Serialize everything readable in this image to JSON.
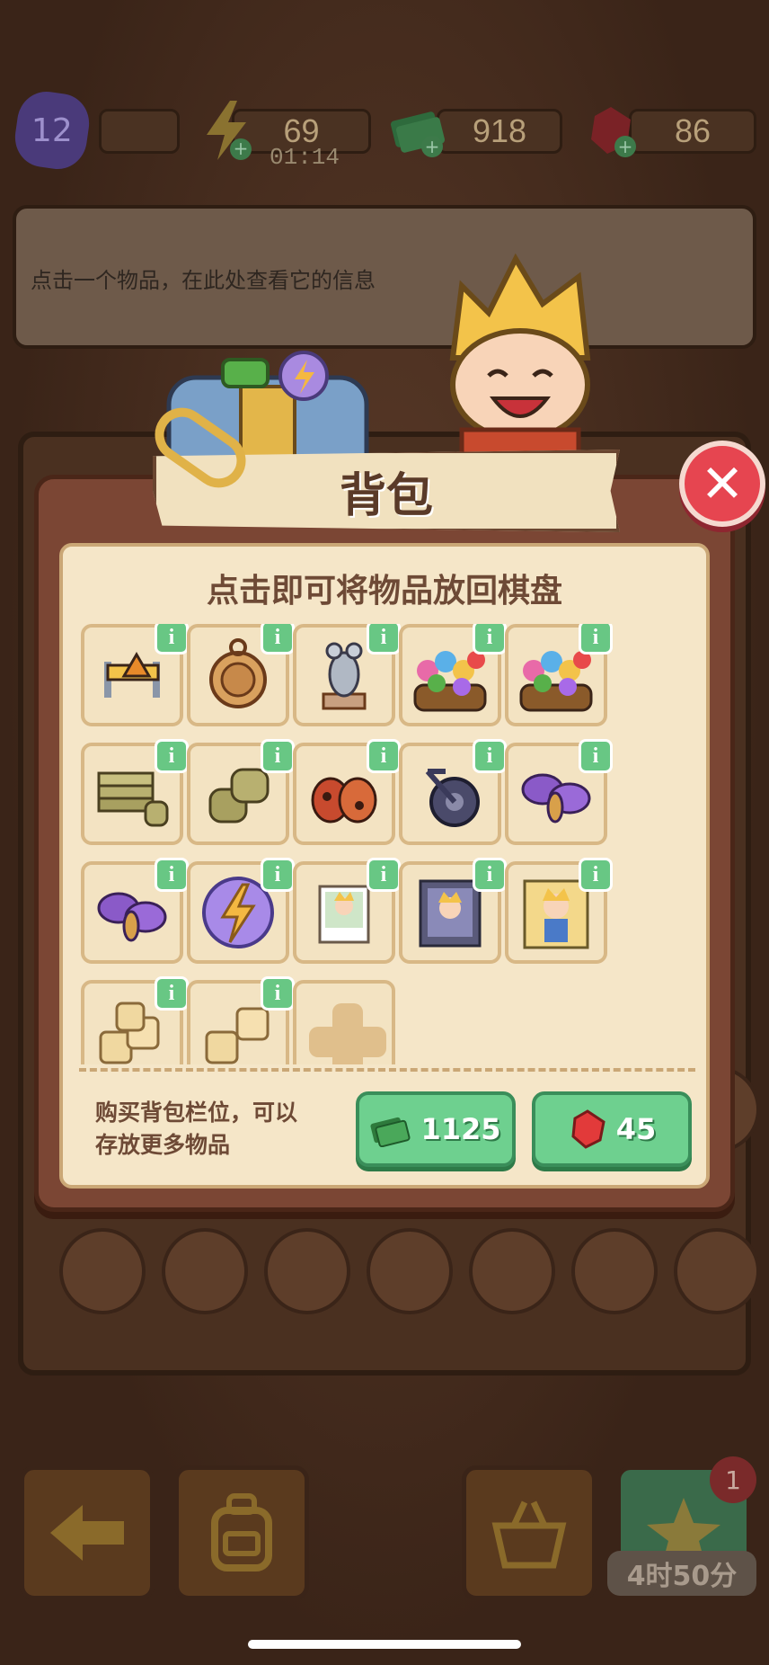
{
  "hud": {
    "level": "12",
    "energy": "69",
    "energy_timer": "01:14",
    "cash": "918",
    "gems": "86"
  },
  "info_panel": {
    "hint": "点击一个物品，在此处查看它的信息"
  },
  "backpack": {
    "title": "背包",
    "subtitle": "点击即可将物品放回棋盘",
    "info_glyph": "i",
    "items": [
      {
        "name": "barrier-sign"
      },
      {
        "name": "coin-locket"
      },
      {
        "name": "mouse-figurine"
      },
      {
        "name": "flower-basket"
      },
      {
        "name": "flower-basket"
      },
      {
        "name": "cloth-stack"
      },
      {
        "name": "cloth-rolls"
      },
      {
        "name": "ladybug-pair"
      },
      {
        "name": "folding-bike"
      },
      {
        "name": "purple-moth"
      },
      {
        "name": "purple-moth"
      },
      {
        "name": "energy-orb"
      },
      {
        "name": "photo-small"
      },
      {
        "name": "photo-medium"
      },
      {
        "name": "photo-large"
      },
      {
        "name": "sugar-cubes"
      },
      {
        "name": "sugar-cubes"
      }
    ],
    "buy_text": "购买背包栏位，可以存放更多物品",
    "buy_cash_price": "1125",
    "buy_gem_price": "45",
    "close_glyph": "✕"
  },
  "bottom": {
    "notification_count": "1",
    "timer": "4时50分"
  },
  "colors": {
    "modal_frame": "#7b4634",
    "inner_panel": "#f5e6c8",
    "buy_button": "#6ed08f",
    "close_button": "#e64550",
    "info_badge": "#68c784"
  }
}
